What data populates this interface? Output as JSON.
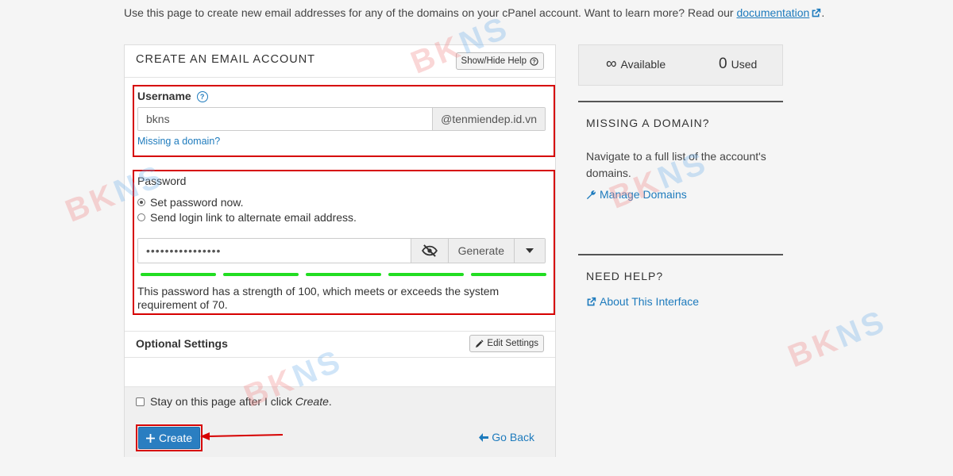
{
  "intro": {
    "text": "Use this page to create new email addresses for any of the domains on your cPanel account. Want to learn more? Read our",
    "doc_link": "documentation",
    "tail": "."
  },
  "form": {
    "title": "CREATE AN EMAIL ACCOUNT",
    "help_button": "Show/Hide Help",
    "username": {
      "label": "Username",
      "value": "bkns",
      "domain": "@tenmiendep.id.vn",
      "missing_link": "Missing a domain?"
    },
    "password": {
      "label": "Password",
      "options": [
        {
          "label": "Set password now.",
          "checked": true
        },
        {
          "label": "Send login link to alternate email address.",
          "checked": false
        }
      ],
      "value": "••••••••••••••••",
      "generate_label": "Generate",
      "strength_text": "This password has a strength of 100, which meets or exceeds the system requirement of 70.",
      "strength_color": "#22dd22"
    },
    "optional": {
      "title": "Optional Settings",
      "edit_button": "Edit Settings"
    },
    "stay_label_prefix": "Stay on this page after I click ",
    "stay_label_em": "Create",
    "stay_label_suffix": ".",
    "create_label": "Create",
    "go_back_label": "Go Back"
  },
  "stats": {
    "available_value": "∞",
    "available_label": "Available",
    "used_value": "0",
    "used_label": "Used"
  },
  "sidebar": {
    "missing_title": "MISSING A DOMAIN?",
    "missing_text": "Navigate to a full list of the account's domains.",
    "manage_link": "Manage Domains",
    "help_title": "NEED HELP?",
    "about_link": "About This Interface"
  },
  "watermark": {
    "part1": "BK",
    "part2": "NS"
  },
  "colors": {
    "accent": "#2a7ec1",
    "highlight_border": "#d60000",
    "link": "#1e7bbd"
  }
}
